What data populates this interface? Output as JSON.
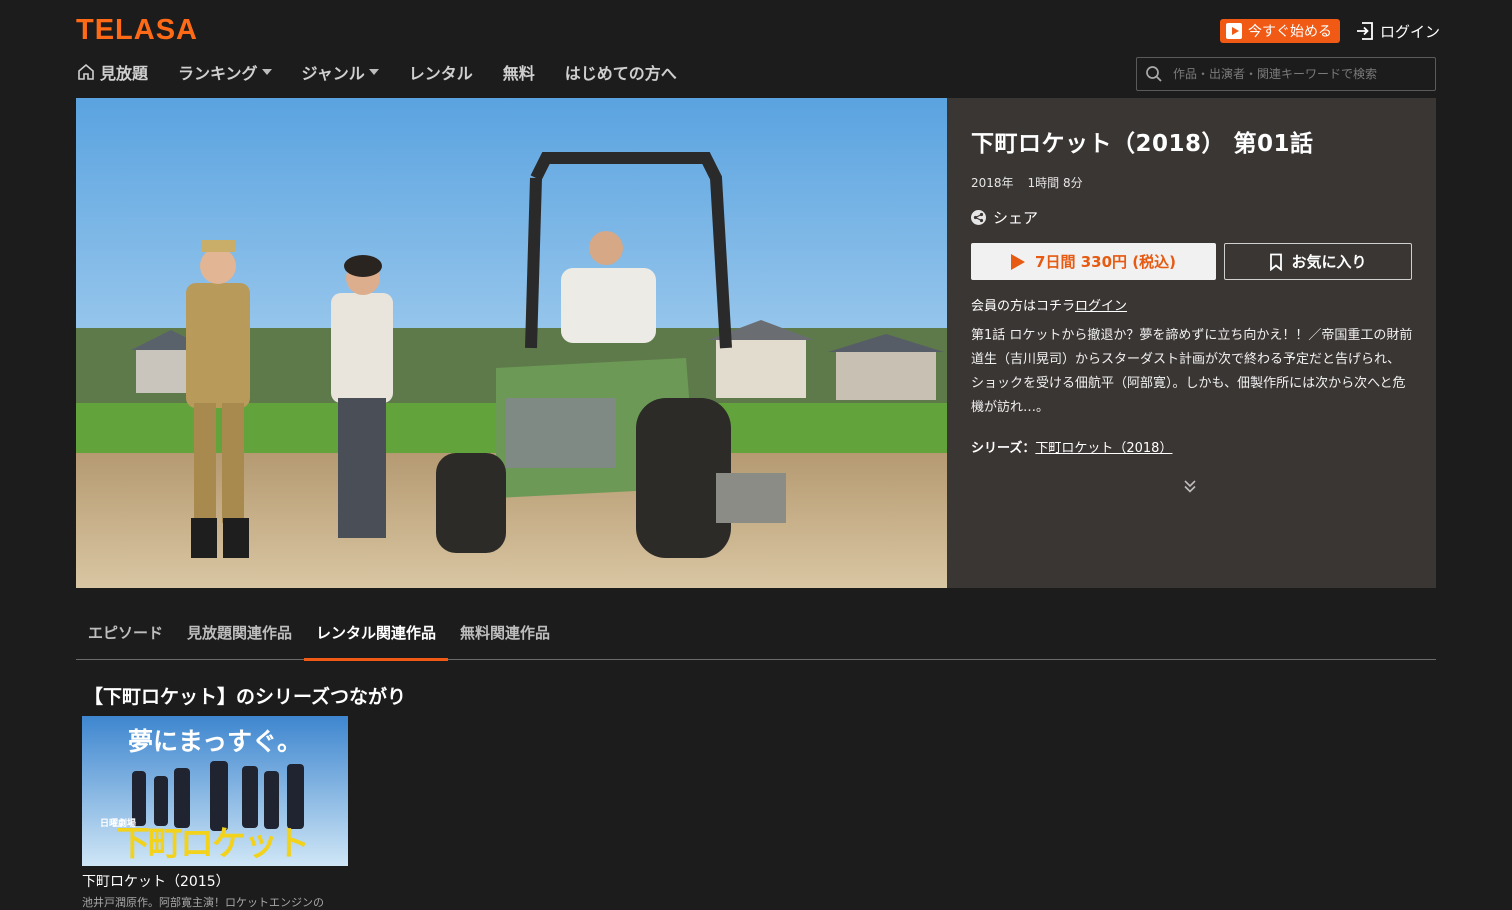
{
  "header": {
    "logo": "TELASA",
    "start_button": "今すぐ始める",
    "login": "ログイン",
    "nav": [
      {
        "label": "見放題",
        "icon": "home-icon"
      },
      {
        "label": "ランキング",
        "dropdown": true
      },
      {
        "label": "ジャンル",
        "dropdown": true
      },
      {
        "label": "レンタル"
      },
      {
        "label": "無料"
      },
      {
        "label": "はじめての方へ"
      }
    ],
    "search_placeholder": "作品・出演者・関連キーワードで検索"
  },
  "episode": {
    "title": "下町ロケット（2018） 第01話",
    "year": "2018年",
    "duration": "1時間 8分",
    "share": "シェア",
    "rent_button": "7日間 330円 (税込)",
    "favorite_button": "お気に入り",
    "member_text": "会員の方はコチラ",
    "member_login": "ログイン",
    "synopsis": "第1話 ロケットから撤退か？夢を諦めずに立ち向かえ！！／帝国重工の財前道生（吉川晃司）からスターダスト計画が次で終わる予定だと告げられ、ショックを受ける佃航平（阿部寛）。しかも、佃製作所には次から次へと危機が訪れ…。",
    "series_label": "シリーズ：",
    "series_link": "下町ロケット（2018）"
  },
  "tabs": [
    {
      "label": "エピソード",
      "active": false
    },
    {
      "label": "見放題関連作品",
      "active": false
    },
    {
      "label": "レンタル関連作品",
      "active": true
    },
    {
      "label": "無料関連作品",
      "active": false
    }
  ],
  "section": {
    "title": "【下町ロケット】のシリーズつながり",
    "cards": [
      {
        "thumb_headline": "夢にまっすぐ。",
        "thumb_logo": "下町ロケット",
        "thumb_badge": "日曜劇場",
        "title": "下町ロケット（2015）",
        "desc": "池井戸潤原作。阿部寛主演！ロケットエンジンの"
      }
    ]
  },
  "colors": {
    "accent": "#f05a14",
    "background": "#1c1c1c",
    "panel": "#3a3634"
  }
}
